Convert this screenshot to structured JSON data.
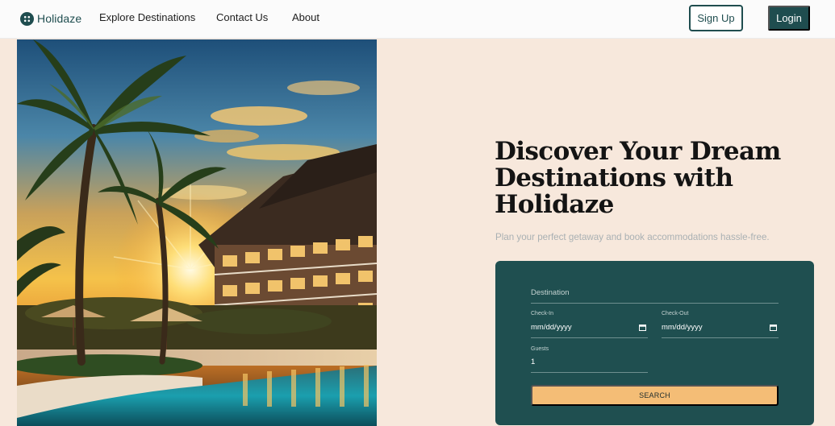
{
  "brand": {
    "name": "Holidaze",
    "logo_icon": "grid-dots-logo-icon",
    "color": "#1f4d4f"
  },
  "nav": {
    "links": [
      "Explore Destinations",
      "Contact Us",
      "About"
    ],
    "signup_label": "Sign Up",
    "login_label": "Login"
  },
  "hero": {
    "image": "tropical-resort-sunset-photo",
    "title_line1": "Discover Your Dream",
    "title_line2": "Destinations with",
    "title_line3": "Holidaze",
    "subtitle": "Plan your perfect getaway and book accommodations hassle-free."
  },
  "search": {
    "destination_placeholder": "Destination",
    "checkin_label": "Check-In",
    "checkin_value": "mm/dd/yyyy",
    "checkout_label": "Check-Out",
    "checkout_value": "mm/dd/yyyy",
    "guests_label": "Guests",
    "guests_value": "1",
    "button_label": "SEARCH",
    "calendar_icon": "calendar-icon"
  },
  "colors": {
    "background": "#f7e8dc",
    "primary": "#1f4f50",
    "accent": "#f4bd76",
    "subtitle_text": "#a9b0b3"
  }
}
